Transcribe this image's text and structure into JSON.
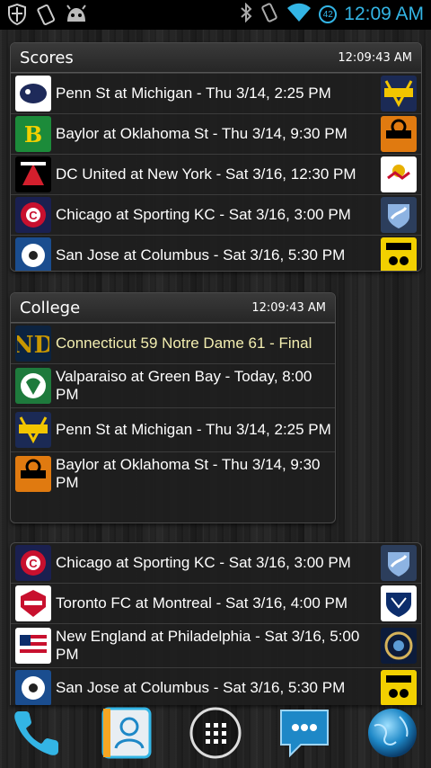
{
  "status_bar": {
    "left_icons": [
      "shield-icon",
      "phone-rotate-icon",
      "android-icon"
    ],
    "right_icons": [
      "bluetooth-icon",
      "vibrate-icon",
      "wifi-icon"
    ],
    "battery_badge": "42",
    "time": "12:09 AM"
  },
  "scores_widget": {
    "title": "Scores",
    "timestamp": "12:09:43 AM",
    "rows": [
      {
        "text": "Penn St at Michigan - Thu 3/14, 2:25 PM",
        "left_logo": "penn-state-logo",
        "right_logo": "michigan-logo"
      },
      {
        "text": "Baylor at Oklahoma St - Thu 3/14, 9:30 PM",
        "left_logo": "baylor-logo",
        "right_logo": "oklahoma-state-logo"
      },
      {
        "text": "DC United at New York - Sat 3/16, 12:30 PM",
        "left_logo": "dc-united-logo",
        "right_logo": "red-bulls-logo"
      },
      {
        "text": "Chicago at Sporting KC - Sat 3/16, 3:00 PM",
        "left_logo": "chicago-fire-logo",
        "right_logo": "sporting-kc-logo"
      },
      {
        "text": "San Jose at Columbus - Sat 3/16, 5:30 PM",
        "left_logo": "san-jose-logo",
        "right_logo": "columbus-crew-logo"
      }
    ]
  },
  "college_widget": {
    "title": "College",
    "timestamp": "12:09:43 AM",
    "rows": [
      {
        "text": "Connecticut 59  Notre Dame 61 - Final",
        "logo": "notre-dame-logo",
        "final": true
      },
      {
        "text": "Valparaiso at Green Bay - Today, 8:00 PM",
        "logo": "green-bay-logo"
      },
      {
        "text": "Penn St at Michigan - Thu 3/14, 2:25 PM",
        "logo": "michigan-logo"
      },
      {
        "text": "Baylor at Oklahoma St - Thu 3/14, 9:30 PM",
        "logo": "oklahoma-state-logo"
      }
    ]
  },
  "soccer_widget": {
    "rows": [
      {
        "text": "Chicago at Sporting KC - Sat 3/16, 3:00 PM",
        "left_logo": "chicago-fire-logo",
        "right_logo": "sporting-kc-logo"
      },
      {
        "text": "Toronto FC at Montreal - Sat 3/16, 4:00 PM",
        "left_logo": "toronto-fc-logo",
        "right_logo": "montreal-impact-logo"
      },
      {
        "text": "New England at Philadelphia - Sat 3/16, 5:00 PM",
        "left_logo": "new-england-logo",
        "right_logo": "philadelphia-union-logo"
      },
      {
        "text": "San Jose at Columbus - Sat 3/16, 5:30 PM",
        "left_logo": "san-jose-logo",
        "right_logo": "columbus-crew-logo"
      }
    ]
  },
  "dock": {
    "icons": [
      "phone-icon",
      "contacts-icon",
      "app-drawer-icon",
      "messaging-icon",
      "browser-icon"
    ]
  },
  "colors": {
    "status_time": "#33b5e5",
    "final_text": "#f3eeb0",
    "widget_bg": "#1e1e1e"
  }
}
